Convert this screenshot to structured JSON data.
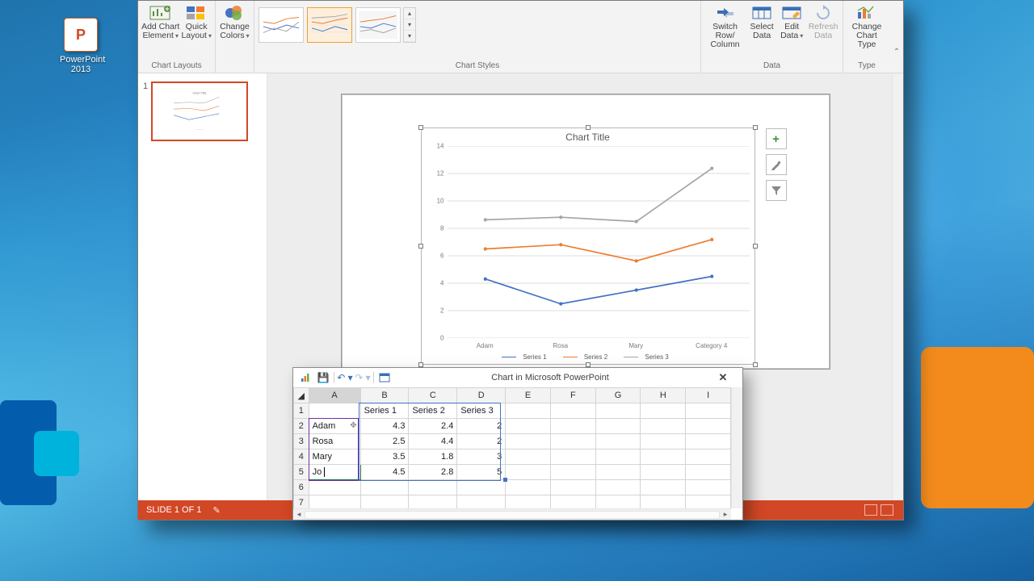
{
  "desktop": {
    "icon_label_1": "PowerPoint",
    "icon_label_2": "2013",
    "icon_glyph": "P"
  },
  "ribbon": {
    "groups": {
      "chart_layouts": "Chart Layouts",
      "chart_styles": "Chart Styles",
      "data": "Data",
      "type": "Type"
    },
    "add_chart_element": {
      "l1": "Add Chart",
      "l2": "Element"
    },
    "quick_layout": {
      "l1": "Quick",
      "l2": "Layout"
    },
    "change_colors": {
      "l1": "Change",
      "l2": "Colors"
    },
    "switch_rowcol": {
      "l1": "Switch Row/",
      "l2": "Column"
    },
    "select_data": {
      "l1": "Select",
      "l2": "Data"
    },
    "edit_data": {
      "l1": "Edit",
      "l2": "Data"
    },
    "refresh_data": {
      "l1": "Refresh",
      "l2": "Data"
    },
    "change_chart_type": {
      "l1": "Change",
      "l2": "Chart Type"
    }
  },
  "statusbar": {
    "slide_pos": "SLIDE 1 OF 1"
  },
  "slide": {
    "thumb_num": "1"
  },
  "chart": {
    "title": "Chart Title",
    "legend": {
      "s1": "Series 1",
      "s2": "Series 2",
      "s3": "Series 3"
    },
    "sidebtns": {
      "plus": "+",
      "brush": "✎",
      "filter": "▾"
    },
    "y_ticks": [
      "0",
      "2",
      "4",
      "6",
      "8",
      "10",
      "12",
      "14"
    ],
    "x_ticks": [
      "Adam",
      "Rosa",
      "Mary",
      "Category 4"
    ]
  },
  "chart_data": {
    "type": "line",
    "categories": [
      "Adam",
      "Rosa",
      "Mary",
      "Category 4"
    ],
    "series": [
      {
        "name": "Series 1",
        "values": [
          4.3,
          2.5,
          3.5,
          4.5
        ],
        "color": "#4472c4"
      },
      {
        "name": "Series 2",
        "values": [
          6.5,
          6.8,
          5.6,
          7.2
        ],
        "color": "#ed7d31"
      },
      {
        "name": "Series 3",
        "values": [
          8.6,
          8.8,
          8.5,
          12.4
        ],
        "color": "#a5a5a5"
      }
    ],
    "title": "Chart Title",
    "xlabel": "",
    "ylabel": "",
    "ylim": [
      0,
      14
    ],
    "y_ticks": [
      0,
      2,
      4,
      6,
      8,
      10,
      12,
      14
    ]
  },
  "xl": {
    "title": "Chart in Microsoft PowerPoint",
    "cols": [
      "A",
      "B",
      "C",
      "D",
      "E",
      "F",
      "G",
      "H",
      "I"
    ],
    "rows": [
      "1",
      "2",
      "3",
      "4",
      "5",
      "6",
      "7"
    ],
    "headers": {
      "B": "Series 1",
      "C": "Series 2",
      "D": "Series 3"
    },
    "data": {
      "r2": {
        "A": "Adam",
        "B": "4.3",
        "C": "2.4",
        "D": "2"
      },
      "r3": {
        "A": "Rosa",
        "B": "2.5",
        "C": "4.4",
        "D": "2"
      },
      "r4": {
        "A": "Mary",
        "B": "3.5",
        "C": "1.8",
        "D": "3"
      },
      "r5": {
        "A": "Jo",
        "B": "4.5",
        "C": "2.8",
        "D": "5"
      }
    }
  }
}
